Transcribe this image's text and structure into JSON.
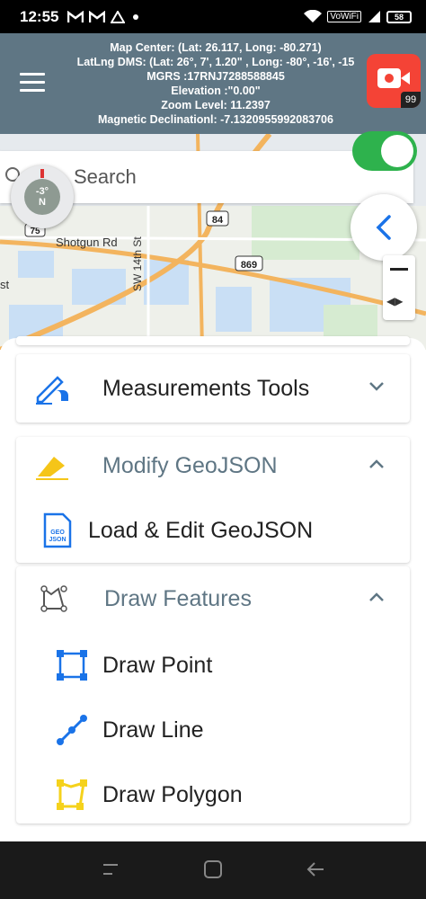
{
  "status": {
    "time": "12:55",
    "vowifi": "VoWiFi",
    "battery": "58"
  },
  "header": {
    "map_center": "Map Center: (Lat: 26.117, Long: -80.271)",
    "latlng_dms": "LatLng DMS: (Lat: 26°, 7', 1.20\" , Long: -80°, -16', -15",
    "mgrs": "MGRS :17RNJ7288588845",
    "elevation": "Elevation :\"0.00\"",
    "zoom_level": "Zoom Level: 11.2397",
    "magnetic": "Magnetic Declinationl: -7.1320955992083706",
    "rec_badge": "99"
  },
  "map": {
    "search_placeholder": "Search",
    "compass_degrees": "-3°",
    "compass_direction": "N",
    "labels": {
      "shotgun_rd": "Shotgun Rd",
      "sw14th": "SW 14th St",
      "route84": "84",
      "route869": "869",
      "route75": "75",
      "st": "st"
    },
    "toggle_on": true
  },
  "panel": {
    "measurements": "Measurements Tools",
    "modify_geojson": "Modify GeoJSON",
    "load_edit": "Load & Edit GeoJSON",
    "geo_icon_text": "GEO JSON",
    "draw_features": "Draw Features",
    "draw_point": "Draw Point",
    "draw_line": "Draw Line",
    "draw_polygon": "Draw Polygon"
  },
  "colors": {
    "header_bg": "#5f7684",
    "accent_blue": "#1a73e8",
    "toggle_green": "#2eb24d",
    "polygon_yellow": "#f5d21c"
  }
}
